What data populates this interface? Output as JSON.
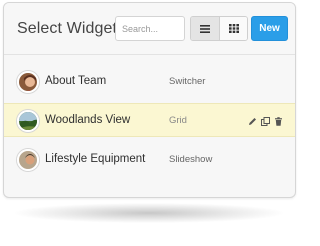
{
  "window": {
    "title": "Select Widget"
  },
  "toolbar": {
    "search_placeholder": "Search...",
    "view_list_icon": "list-icon",
    "view_grid_icon": "grid-icon",
    "new_label": "New"
  },
  "colors": {
    "accent": "#2b9ee8",
    "selected_row": "#fbf7d2"
  },
  "widgets": [
    {
      "name": "About Team",
      "type": "Switcher",
      "avatar": "person-photo",
      "selected": false
    },
    {
      "name": "Woodlands View",
      "type": "Grid",
      "avatar": "landscape-photo",
      "selected": true,
      "actions": [
        "pencil-icon",
        "copy-icon",
        "trash-icon"
      ]
    },
    {
      "name": "Lifestyle Equipment",
      "type": "Slideshow",
      "avatar": "equipment-photo",
      "selected": false
    }
  ]
}
